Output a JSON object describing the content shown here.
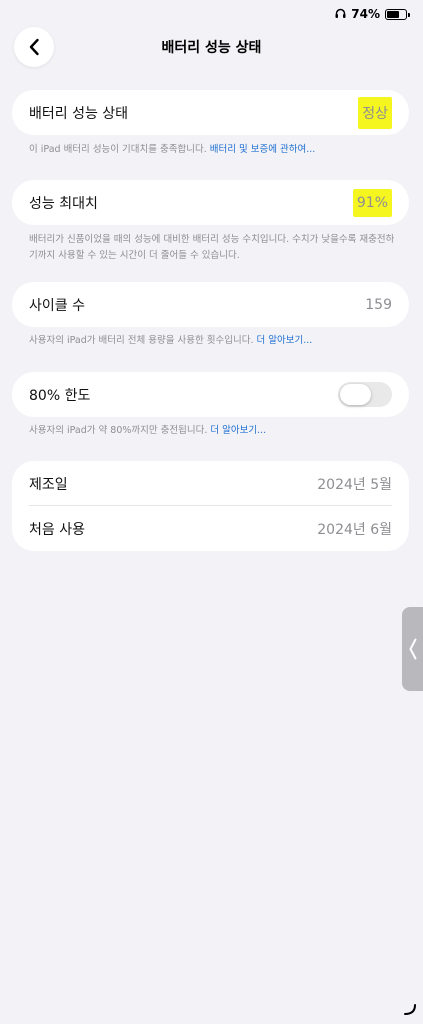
{
  "status": {
    "battery_percent": "74%",
    "battery_level": 0.74
  },
  "nav": {
    "title": "배터리 성능 상태"
  },
  "health": {
    "label": "배터리 성능 상태",
    "value": "정상",
    "footnote": "이 iPad 배터리 성능이 기대치를 충족합니다.",
    "footnote_link": "배터리 및 보증에 관하여..."
  },
  "max_capacity": {
    "label": "성능 최대치",
    "value": "91%",
    "footnote": "배터리가 신품이었을 때의 성능에 대비한 배터리 성능 수치입니다. 수치가 낮을수록 재충전하기까지 사용할 수 있는 시간이 더 줄어들 수 있습니다."
  },
  "cycle": {
    "label": "사이클 수",
    "value": "159",
    "footnote": "사용자의 iPad가 배터리 전체 용량을 사용한 횟수입니다.",
    "footnote_link": "더 알아보기..."
  },
  "limit": {
    "label": "80% 한도",
    "enabled": false,
    "footnote": "사용자의 iPad가 약 80%까지만 충전됩니다.",
    "footnote_link": "더 알아보기..."
  },
  "dates": [
    {
      "label": "제조일",
      "value": "2024년 5월"
    },
    {
      "label": "처음 사용",
      "value": "2024년 6월"
    }
  ],
  "colors": {
    "highlight": "#f5f51f",
    "link": "#1f6fd1",
    "background": "#f2f2f7"
  }
}
